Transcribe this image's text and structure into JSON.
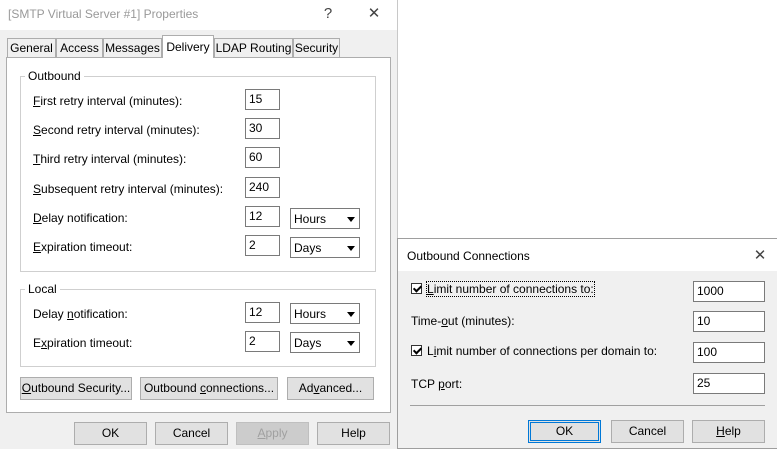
{
  "main_dialog": {
    "title": "[SMTP Virtual Server #1] Properties",
    "help_glyph": "?",
    "close_glyph": "✕",
    "tabs": [
      {
        "label": "General"
      },
      {
        "label": "Access"
      },
      {
        "label": "Messages"
      },
      {
        "label": "Delivery"
      },
      {
        "label": "LDAP Routing"
      },
      {
        "label": "Security"
      }
    ],
    "active_tab": "Delivery",
    "outbound": {
      "legend": "Outbound",
      "first_retry": {
        "ul": "F",
        "rest": "irst retry interval (minutes):",
        "value": "15"
      },
      "second_retry": {
        "ul": "S",
        "pre": "",
        "rest": "econd retry interval (minutes):",
        "value": "30"
      },
      "third_retry": {
        "ul": "T",
        "rest": "hird retry interval (minutes):",
        "value": "60"
      },
      "subsequent_retry": {
        "ul": "S",
        "rest": "ubsequent retry interval (minutes):",
        "value": "240"
      },
      "delay_notification": {
        "ul": "D",
        "rest": "elay notification:",
        "value": "12",
        "unit": "Hours"
      },
      "expiration_timeout": {
        "ul": "E",
        "rest": "xpiration timeout:",
        "value": "2",
        "unit": "Days"
      }
    },
    "local": {
      "legend": "Local",
      "delay_notification": {
        "pre": "Delay ",
        "ul": "n",
        "rest": "otification:",
        "value": "12",
        "unit": "Hours"
      },
      "expiration_timeout": {
        "pre": "E",
        "ul": "x",
        "rest": "piration timeout:",
        "value": "2",
        "unit": "Days"
      }
    },
    "buttons": {
      "outbound_security": {
        "pre": "",
        "ul": "O",
        "rest": "utbound Security..."
      },
      "outbound_connections": {
        "pre": "Outbound ",
        "ul": "c",
        "rest": "onnections..."
      },
      "advanced": {
        "pre": "Ad",
        "ul": "v",
        "rest": "anced..."
      },
      "ok": "OK",
      "cancel": "Cancel",
      "apply": {
        "ul": "A",
        "rest": "pply"
      },
      "help": "Help"
    }
  },
  "oc_dialog": {
    "title": "Outbound Connections",
    "close_glyph": "✕",
    "limit_connections": {
      "pre": "",
      "ul": "L",
      "rest": "imit number of connections to:",
      "checked": true,
      "value": "1000"
    },
    "timeout": {
      "pre": "Time-",
      "ul": "o",
      "rest": "ut (minutes):",
      "value": "10"
    },
    "limit_per_domain": {
      "pre": "L",
      "ul": "i",
      "rest": "mit number of connections per domain to:",
      "checked": true,
      "value": "100"
    },
    "tcp_port": {
      "pre": "TCP ",
      "ul": "p",
      "rest": "ort:",
      "value": "25"
    },
    "buttons": {
      "ok": "OK",
      "cancel": "Cancel",
      "help": {
        "ul": "H",
        "rest": "elp"
      }
    }
  }
}
